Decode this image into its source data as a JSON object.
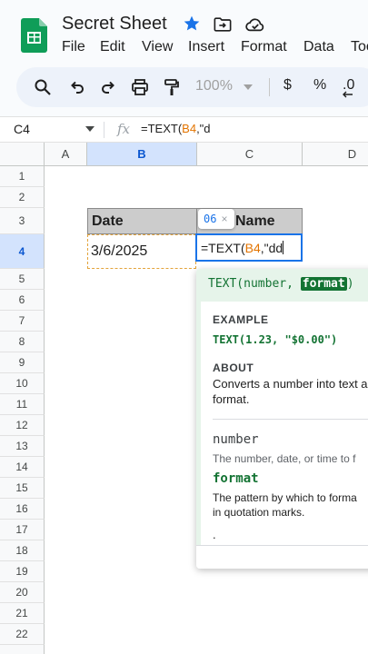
{
  "app": {
    "title": "Secret Sheet",
    "menu": [
      "File",
      "Edit",
      "View",
      "Insert",
      "Format",
      "Data",
      "Too"
    ]
  },
  "toolbar": {
    "zoom": "100%",
    "currency": "$",
    "percent": "%",
    "decimal": ".0"
  },
  "formula_bar": {
    "cell_ref": "C4",
    "fx": "fx",
    "formula_prefix": "=TEXT(",
    "formula_ref": "B4",
    "formula_suffix": ",\"d"
  },
  "grid": {
    "columns": [
      "A",
      "B",
      "C",
      "D"
    ],
    "selected_column": "B",
    "rows": [
      "1",
      "2",
      "3",
      "4",
      "5",
      "6",
      "7",
      "8",
      "9",
      "10",
      "11",
      "12",
      "13",
      "14",
      "15",
      "16",
      "17",
      "18",
      "19",
      "20",
      "21",
      "22"
    ],
    "selected_row": "4",
    "header_cells": {
      "b3": "Date",
      "c3": "Name"
    },
    "b4_value": "3/6/2025",
    "editor": {
      "prefix": "=TEXT(",
      "ref": "B4",
      "suffix": ",\"dd"
    },
    "chip": {
      "value": "06",
      "close": "×"
    }
  },
  "help_popup": {
    "signature_prefix": "TEXT(number, ",
    "signature_active": "format",
    "signature_suffix": ")",
    "example_label": "EXAMPLE",
    "example_code": "TEXT(1.23, \"$0.00\")",
    "about_label": "ABOUT",
    "about_line1": "Converts a number into text a",
    "about_line2": "format.",
    "arg1_name": "number",
    "arg1_desc": "The number, date, or time to f",
    "arg2_name": "format",
    "arg2_line1": "The pattern by which to forma",
    "arg2_line2": "in quotation marks.",
    "more": "."
  },
  "colors": {
    "accent": "#1a73e8",
    "selection": "#d3e3fd",
    "green": "#137333",
    "green_bg": "#e6f4ea",
    "ref_orange": "#e37400"
  }
}
